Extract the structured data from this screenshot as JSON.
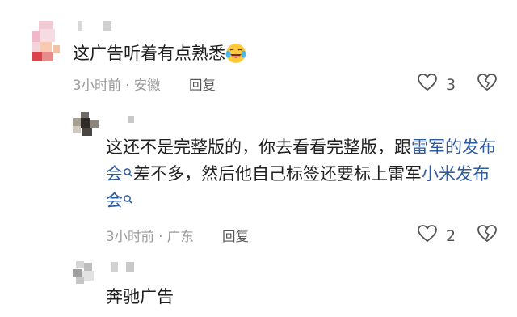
{
  "comments": [
    {
      "text": "这广告听着有点熟悉",
      "time": "3小时前",
      "location": "安徽",
      "reply_label": "回复",
      "likes": "3",
      "has_emoji": true
    },
    {
      "text_parts": [
        {
          "text": "这还不是完整版的，你去看看完整版，跟",
          "link": false
        },
        {
          "text": "雷军的发布会",
          "link": true
        },
        {
          "text": "差不多，然后他自己标签还要标上雷军",
          "link": false
        },
        {
          "text": "小米发布会",
          "link": true
        }
      ],
      "time": "3小时前",
      "location": "广东",
      "reply_label": "回复",
      "likes": "2"
    },
    {
      "text": "奔驰广告"
    }
  ],
  "colors": {
    "link": "#2f5c9c",
    "meta": "#9a9a9a",
    "text": "#1f1f1f"
  },
  "icons": {
    "like": "heart-icon",
    "dislike": "broken-heart-icon",
    "search": "search-icon",
    "emoji": "laughing-crying-emoji-icon"
  }
}
